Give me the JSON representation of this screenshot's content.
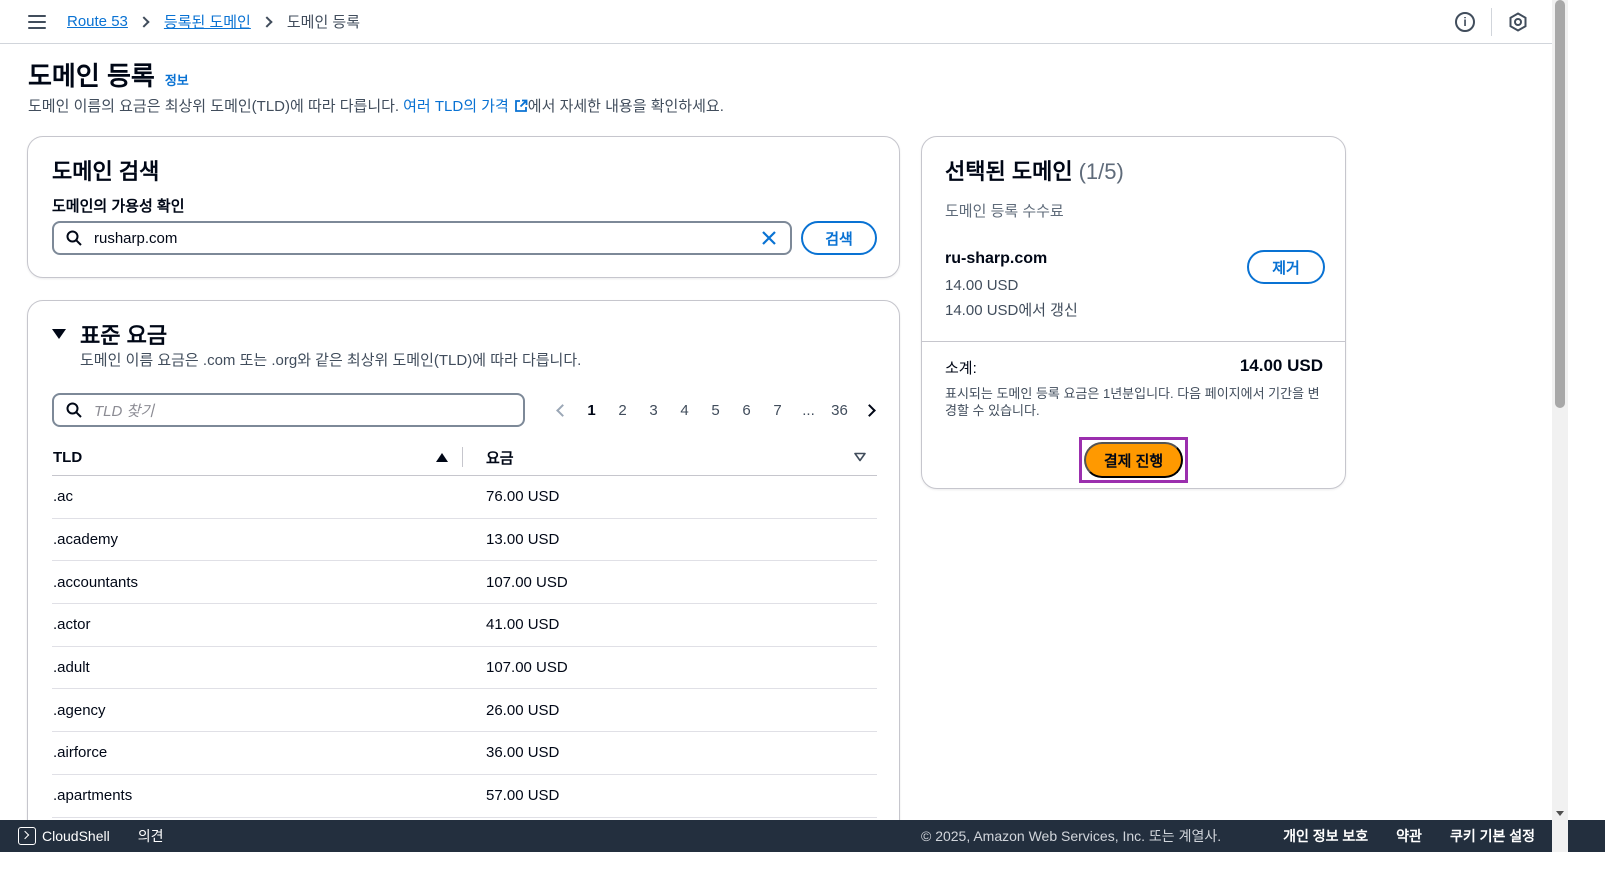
{
  "breadcrumb": {
    "items": [
      "Route 53",
      "등록된 도메인",
      "도메인 등록"
    ]
  },
  "page": {
    "title": "도메인 등록",
    "info_link": "정보",
    "description_prefix": "도메인 이름의 요금은 최상위 도메인(TLD)에 따라 다릅니다.",
    "description_link": "여러 TLD의 가격",
    "description_suffix": "에서 자세한 내용을 확인하세요."
  },
  "search": {
    "title": "도메인 검색",
    "field_label": "도메인의 가용성 확인",
    "value": "rusharp.com",
    "button_label": "검색"
  },
  "pricing": {
    "title": "표준 요금",
    "description": "도메인 이름 요금은 .com 또는 .org와 같은 최상위 도메인(TLD)에 따라 다릅니다.",
    "filter_placeholder": "TLD 찾기",
    "pagination": {
      "pages": [
        "1",
        "2",
        "3",
        "4",
        "5",
        "6",
        "7",
        "...",
        "36"
      ],
      "current": "1"
    },
    "columns": [
      "TLD",
      "요금"
    ],
    "rows": [
      {
        "tld": ".ac",
        "price": "76.00 USD"
      },
      {
        "tld": ".academy",
        "price": "13.00 USD"
      },
      {
        "tld": ".accountants",
        "price": "107.00 USD"
      },
      {
        "tld": ".actor",
        "price": "41.00 USD"
      },
      {
        "tld": ".adult",
        "price": "107.00 USD"
      },
      {
        "tld": ".agency",
        "price": "26.00 USD"
      },
      {
        "tld": ".airforce",
        "price": "36.00 USD"
      },
      {
        "tld": ".apartments",
        "price": "57.00 USD"
      }
    ]
  },
  "selected": {
    "title": "선택된 도메인",
    "count": "(1/5)",
    "subtitle": "도메인 등록 수수료",
    "domain": "ru-sharp.com",
    "price": "14.00 USD",
    "renewal": "14.00 USD에서 갱신",
    "remove_label": "제거",
    "subtotal_label": "소계:",
    "subtotal_value": "14.00 USD",
    "note": "표시되는 도메인 등록 요금은 1년분입니다. 다음 페이지에서 기간을 변경할 수 있습니다.",
    "checkout_label": "결제 진행"
  },
  "footer": {
    "cloudshell": "CloudShell",
    "feedback": "의견",
    "copyright": "© 2025, Amazon Web Services, Inc. 또는 계열사.",
    "links": [
      "개인 정보 보호",
      "약관",
      "쿠키 기본 설정"
    ]
  },
  "colors": {
    "link": "#0972d3",
    "primary_button": "#ff9900",
    "highlight": "#9b2fae",
    "footer_bg": "#232f3e"
  }
}
